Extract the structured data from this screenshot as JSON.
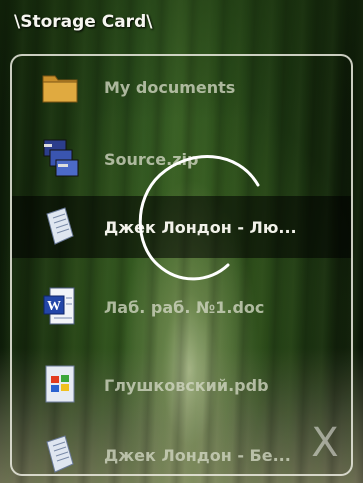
{
  "header": {
    "path": "\\Storage Card\\"
  },
  "files": [
    {
      "label": "My documents",
      "icon": "folder-icon"
    },
    {
      "label": "Source.zip",
      "icon": "zip-archive-icon"
    },
    {
      "label": "Джек Лондон - Лю...",
      "icon": "text-document-icon",
      "selected": true
    },
    {
      "label": "Лаб. раб. №1.doc",
      "icon": "word-document-icon"
    },
    {
      "label": "Глушковский.pdb",
      "icon": "windows-file-icon"
    },
    {
      "label": "Джек Лондон - Бе...",
      "icon": "text-document-icon"
    }
  ],
  "close": {
    "label": "X",
    "icon": "close-icon"
  },
  "gesture": {
    "icon": "gesture-stroke-icon"
  }
}
